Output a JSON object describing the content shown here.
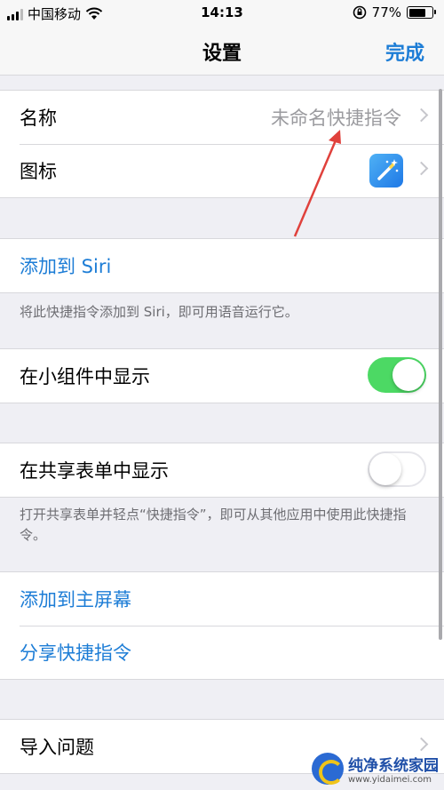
{
  "status_bar": {
    "carrier": "中国移动",
    "time": "14:13",
    "battery_text": "77%",
    "battery_level": 0.77
  },
  "nav": {
    "title": "设置",
    "done_label": "完成"
  },
  "name_row": {
    "label": "名称",
    "value": "未命名快捷指令"
  },
  "icon_row": {
    "label": "图标",
    "icon": "magic-wand-icon"
  },
  "siri": {
    "label": "添加到 Siri",
    "footnote": "将此快捷指令添加到 Siri，即可用语音运行它。"
  },
  "widget": {
    "label": "在小组件中显示",
    "enabled": true
  },
  "share_sheet": {
    "label": "在共享表单中显示",
    "enabled": false,
    "footnote": "打开共享表单并轻点“快捷指令”，即可从其他应用中使用此快捷指令。"
  },
  "actions": {
    "add_home": "添加到主屏幕",
    "share": "分享快捷指令"
  },
  "import_row": {
    "label": "导入问题"
  },
  "colors": {
    "accent": "#1d7dd6",
    "toggle_on": "#4cd964",
    "annotation_arrow": "#e0413c"
  },
  "watermark": {
    "name": "纯净系统家园",
    "url": "www.yidaimei.com"
  }
}
